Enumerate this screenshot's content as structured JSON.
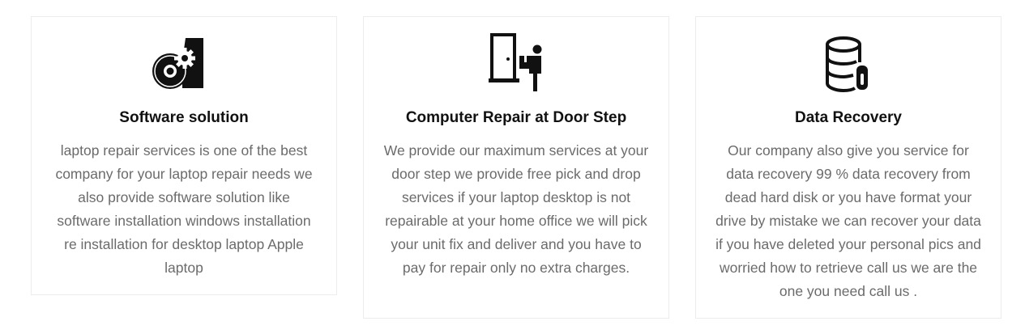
{
  "services": [
    {
      "icon": "software-disc-gear-icon",
      "title": "Software solution",
      "description": "laptop repair services is one of the best company for your laptop repair needs we also provide software solution like software installation windows installation re installation for desktop laptop Apple laptop"
    },
    {
      "icon": "door-delivery-person-icon",
      "title": "Computer Repair at Door Step",
      "description": "We provide our maximum services at your door step we provide free pick and drop services if your laptop desktop is not repairable at your home office we will pick your unit fix and deliver and you have to pay for repair only no extra charges."
    },
    {
      "icon": "database-storage-icon",
      "title": "Data Recovery",
      "description": " Our company also give you service for data recovery 99 % data recovery from dead hard disk or you have format your drive by mistake we can recover your data if you have deleted your personal pics and worried how to retrieve call us we are the one you need call us ."
    }
  ],
  "colors": {
    "title": "#111111",
    "text": "#6b6b6b",
    "border": "#ececec",
    "icon": "#111111"
  }
}
